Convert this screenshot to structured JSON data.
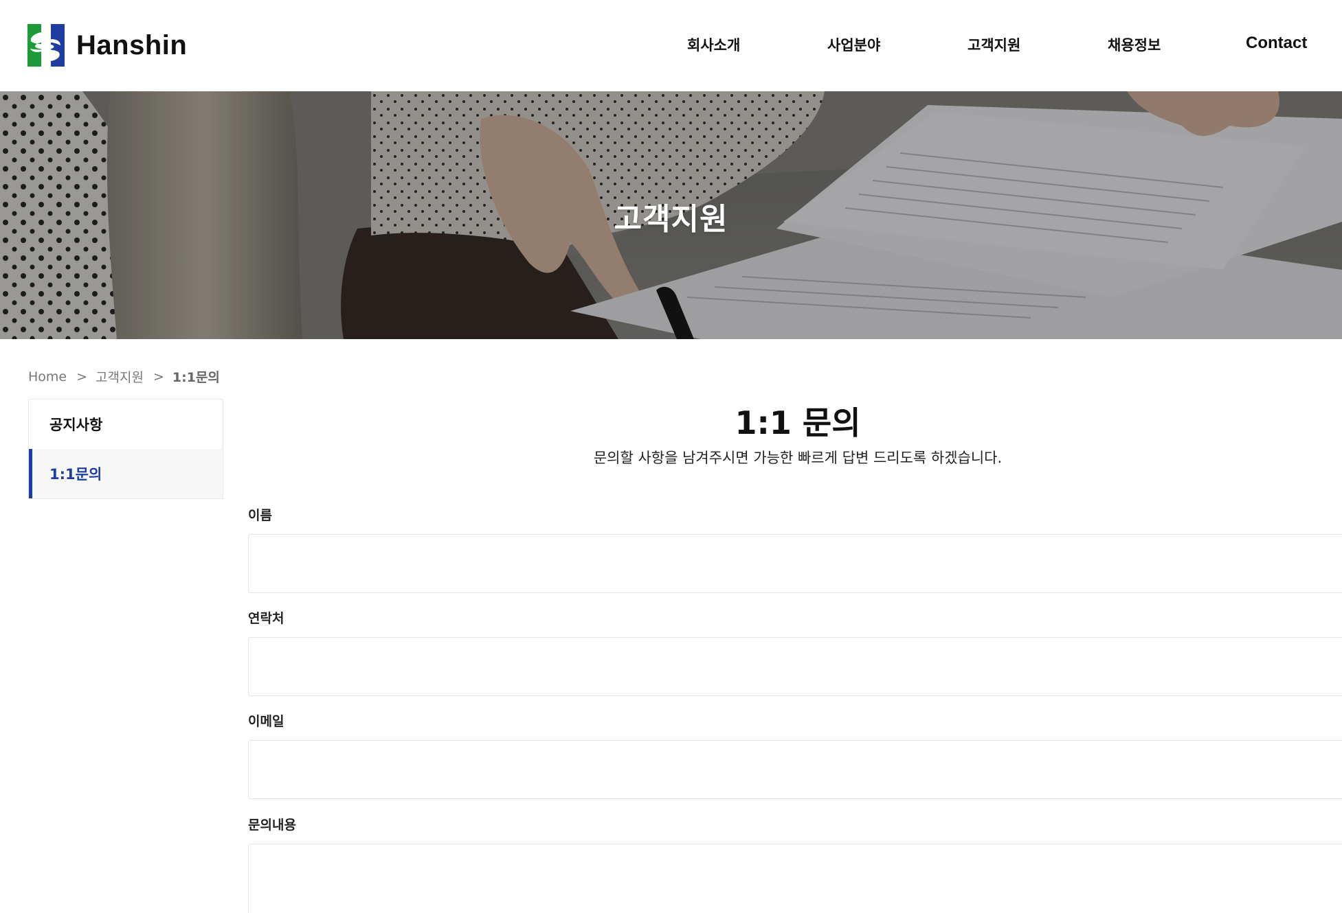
{
  "brand": {
    "name": "Hanshin",
    "colors": {
      "green": "#1f9a3a",
      "blue": "#1e3da0",
      "accent": "#1e3da0"
    }
  },
  "nav": {
    "items": [
      {
        "label": "회사소개"
      },
      {
        "label": "사업분야"
      },
      {
        "label": "고객지원"
      },
      {
        "label": "채용정보"
      },
      {
        "label": "Contact"
      }
    ]
  },
  "hero": {
    "title": "고객지원"
  },
  "breadcrumb": {
    "home": "Home",
    "separator": ">",
    "section": "고객지원",
    "current": "1:1문의"
  },
  "sidebar": {
    "items": [
      {
        "label": "공지사항",
        "active": false
      },
      {
        "label": "1:1문의",
        "active": true
      }
    ]
  },
  "main": {
    "title": "1:1 문의",
    "description": "문의할 사항을 남겨주시면 가능한 빠르게 답변 드리도록 하겠습니다."
  },
  "form": {
    "name_label": "이름",
    "name_value": "",
    "phone_label": "연락처",
    "phone_value": "",
    "email_label": "이메일",
    "email_value": "",
    "message_label": "문의내용",
    "message_value": ""
  }
}
